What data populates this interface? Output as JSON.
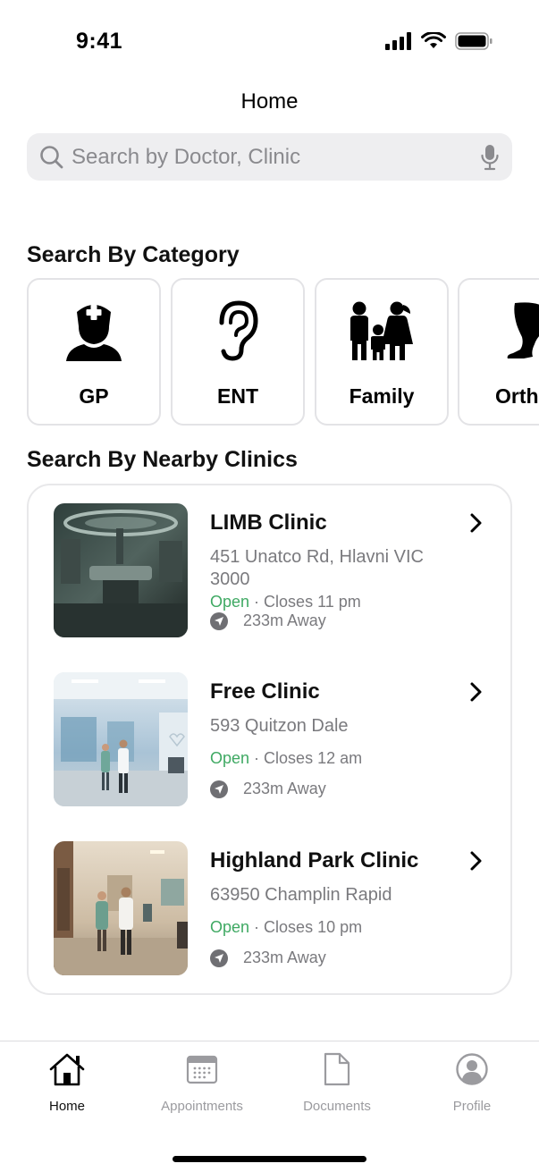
{
  "status_bar": {
    "time": "9:41"
  },
  "header": {
    "title": "Home"
  },
  "search": {
    "placeholder": "Search by Doctor, Clinic"
  },
  "categories_section": {
    "title": "Search By Category",
    "items": [
      {
        "label": "GP",
        "icon": "doctor-icon"
      },
      {
        "label": "ENT",
        "icon": "ear-icon"
      },
      {
        "label": "Family",
        "icon": "family-icon"
      },
      {
        "label": "Orth",
        "icon": "leg-icon"
      }
    ]
  },
  "clinics_section": {
    "title": "Search By Nearby Clinics",
    "items": [
      {
        "name": "LIMB Clinic",
        "address": "451 Unatco Rd, Hlavni VIC 3000",
        "status": "Open",
        "separator": " · ",
        "closes": "Closes 11 pm",
        "distance": "233m Away"
      },
      {
        "name": "Free Clinic",
        "address": "593 Quitzon Dale",
        "status": "Open",
        "separator": " · ",
        "closes": "Closes 12 am",
        "distance": "233m Away"
      },
      {
        "name": "Highland Park Clinic",
        "address": "63950 Champlin Rapid",
        "status": "Open",
        "separator": " · ",
        "closes": "Closes 10 pm",
        "distance": "233m Away"
      }
    ]
  },
  "tab_bar": {
    "items": [
      {
        "label": "Home",
        "icon": "home-icon",
        "active": true
      },
      {
        "label": "Appointments",
        "icon": "calendar-icon",
        "active": false
      },
      {
        "label": "Documents",
        "icon": "document-icon",
        "active": false
      },
      {
        "label": "Profile",
        "icon": "profile-icon",
        "active": false
      }
    ]
  },
  "colors": {
    "open_status": "#3fa963",
    "search_bg": "#eeeef0",
    "muted_text": "#7a7a7e",
    "card_border": "#e3e3e6"
  }
}
